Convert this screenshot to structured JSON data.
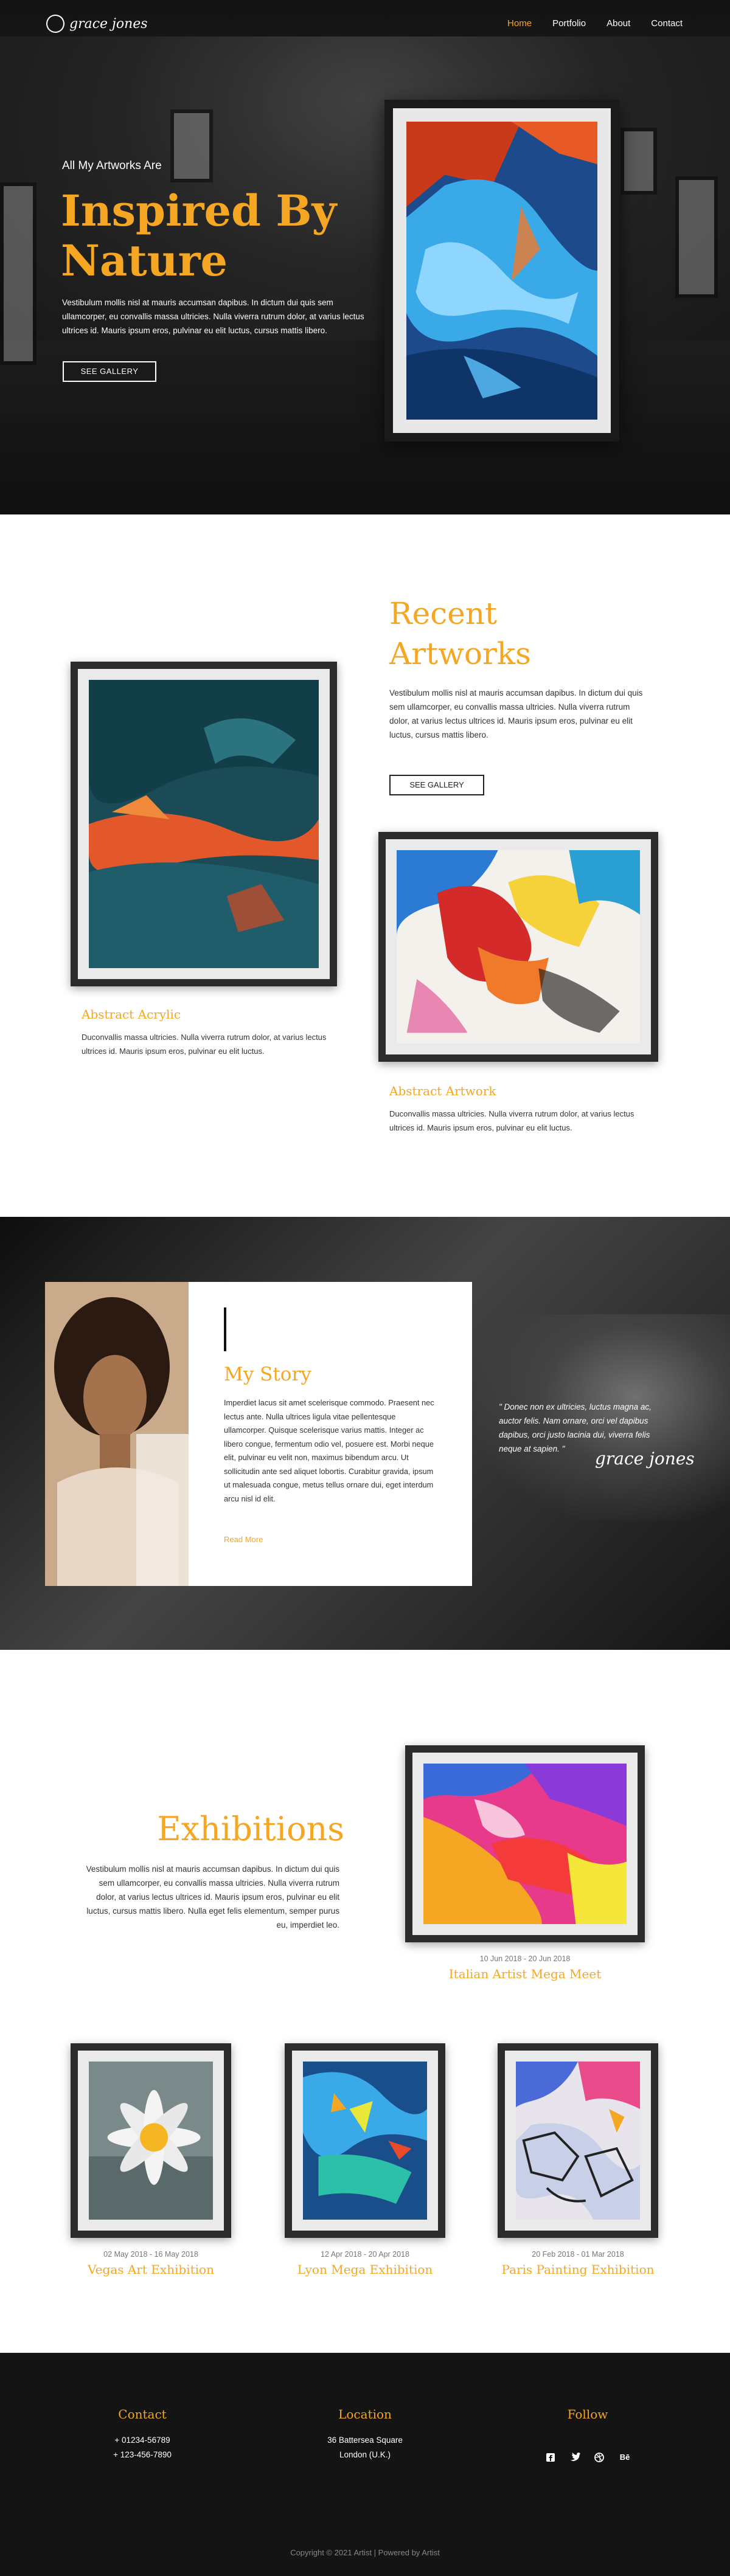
{
  "brand": {
    "logo_text": "grace jones"
  },
  "nav": {
    "items": [
      {
        "label": "Home",
        "active": true
      },
      {
        "label": "Portfolio",
        "active": false
      },
      {
        "label": "About",
        "active": false
      },
      {
        "label": "Contact",
        "active": false
      }
    ]
  },
  "hero": {
    "kicker": "All My Artworks Are",
    "title": "Inspired By Nature",
    "text": "Vestibulum mollis nisl at mauris accumsan dapibus. In dictum dui quis sem ullamcorper, eu convallis massa ultricies. Nulla viverra rutrum dolor, at varius lectus ultrices id. Mauris ipsum eros, pulvinar eu elit luctus, cursus mattis libero.",
    "button": "SEE GALLERY"
  },
  "recent": {
    "title": "Recent Artworks",
    "text": "Vestibulum mollis nisl at mauris accumsan dapibus. In dictum dui quis sem ullamcorper, eu convallis massa ultricies. Nulla viverra rutrum dolor, at varius lectus ultrices id. Mauris ipsum eros, pulvinar eu elit luctus, cursus mattis libero.",
    "button": "SEE GALLERY",
    "works": [
      {
        "title": "Abstract Acrylic",
        "text": "Duconvallis massa ultricies. Nulla viverra rutrum dolor, at varius lectus ultrices id. Mauris ipsum eros, pulvinar eu elit luctus."
      },
      {
        "title": "Abstract Artwork",
        "text": "Duconvallis massa ultricies. Nulla viverra rutrum dolor, at varius lectus ultrices id. Mauris ipsum eros, pulvinar eu elit luctus."
      }
    ]
  },
  "story": {
    "title": "My Story",
    "text": "Imperdiet lacus sit amet scelerisque commodo. Praesent nec lectus ante. Nulla ultrices ligula vitae pellentesque ullamcorper. Quisque scelerisque varius mattis. Integer ac libero congue, fermentum odio vel, posuere est. Morbi neque elit, pulvinar eu velit non, maximus bibendum arcu. Ut sollicitudin ante sed aliquet lobortis. Curabitur gravida, ipsum ut malesuada congue, metus tellus ornare dui, eget interdum arcu nisl id elit.",
    "link": "Read More",
    "quote": "\" Donec non ex ultricies, luctus magna ac, auctor felis. Nam ornare, orci vel dapibus dapibus, orci justo lacinia dui, viverra felis neque at sapien. \"",
    "signature": "grace jones"
  },
  "exhibitions": {
    "title": "Exhibitions",
    "text": "Vestibulum mollis nisl at mauris accumsan dapibus. In dictum dui quis sem ullamcorper, eu convallis massa ultricies. Nulla viverra rutrum dolor, at varius lectus ultrices id. Mauris ipsum eros, pulvinar eu elit luctus, cursus mattis libero. Nulla eget felis elementum, semper purus eu, imperdiet leo.",
    "featured": {
      "date": "10 Jun 2018 - 20 Jun 2018",
      "name": "Italian Artist Mega Meet"
    },
    "items": [
      {
        "date": "02 May 2018 - 16 May 2018",
        "name": "Vegas Art Exhibition"
      },
      {
        "date": "12 Apr 2018 - 20 Apr 2018",
        "name": "Lyon Mega Exhibition"
      },
      {
        "date": "20 Feb 2018 - 01 Mar 2018",
        "name": "Paris Painting Exhibition"
      }
    ]
  },
  "footer": {
    "contact": {
      "title": "Contact",
      "lines": [
        "+ 01234-56789",
        "+ 123-456-7890"
      ]
    },
    "location": {
      "title": "Location",
      "lines": [
        "36 Battersea Square",
        "London (U.K.)"
      ]
    },
    "follow": {
      "title": "Follow",
      "icons": [
        "facebook-icon",
        "twitter-icon",
        "dribbble-icon",
        "behance-icon"
      ]
    },
    "copyright": "Copyright © 2021 Artist | Powered by Artist"
  },
  "colors": {
    "accent": "#f5a623",
    "dark": "#141414"
  }
}
